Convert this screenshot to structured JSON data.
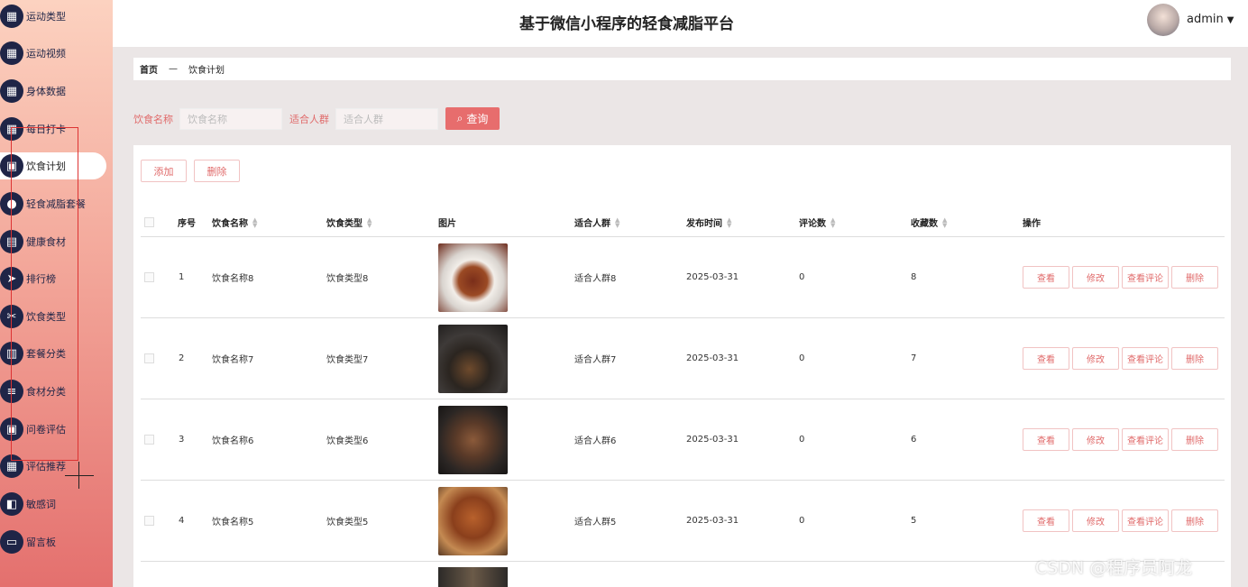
{
  "header": {
    "title": "基于微信小程序的轻食减脂平台",
    "user": "admin"
  },
  "sidebar": {
    "items": [
      {
        "label": "运动类型",
        "icon": "grid-icon"
      },
      {
        "label": "运动视频",
        "icon": "grid-icon"
      },
      {
        "label": "身体数据",
        "icon": "grid-icon"
      },
      {
        "label": "每日打卡",
        "icon": "grid-icon"
      },
      {
        "label": "饮食计划",
        "icon": "board-icon"
      },
      {
        "label": "轻食减脂套餐",
        "icon": "user-icon"
      },
      {
        "label": "健康食材",
        "icon": "clipboard-icon"
      },
      {
        "label": "排行榜",
        "icon": "send-icon"
      },
      {
        "label": "饮食类型",
        "icon": "ticket-icon"
      },
      {
        "label": "套餐分类",
        "icon": "bar-chart-icon"
      },
      {
        "label": "食材分类",
        "icon": "sliders-icon"
      },
      {
        "label": "问卷评估",
        "icon": "board-icon"
      },
      {
        "label": "评估推荐",
        "icon": "grid-icon"
      },
      {
        "label": "敏感词",
        "icon": "wallet-icon"
      },
      {
        "label": "留言板",
        "icon": "briefcase-icon"
      }
    ],
    "active_index": 4
  },
  "breadcrumb": {
    "home": "首页",
    "sep": "—",
    "current": "饮食计划"
  },
  "search": {
    "name_label": "饮食名称",
    "name_placeholder": "饮食名称",
    "crowd_label": "适合人群",
    "crowd_placeholder": "适合人群",
    "query_label": "查询"
  },
  "toolbar": {
    "add_label": "添加",
    "delete_label": "删除"
  },
  "table": {
    "headers": [
      "序号",
      "饮食名称",
      "饮食类型",
      "图片",
      "适合人群",
      "发布时间",
      "评论数",
      "收藏数",
      "操作"
    ],
    "rows": [
      {
        "no": "1",
        "name": "饮食名称8",
        "type": "饮食类型8",
        "crowd": "适合人群8",
        "date": "2025-03-31",
        "comments": "0",
        "favorites": "8",
        "image": "plated-meat-dish"
      },
      {
        "no": "2",
        "name": "饮食名称7",
        "type": "饮食类型7",
        "crowd": "适合人群7",
        "date": "2025-03-31",
        "comments": "0",
        "favorites": "7",
        "image": "teapot-and-plate"
      },
      {
        "no": "3",
        "name": "饮食名称6",
        "type": "饮食类型6",
        "crowd": "适合人群6",
        "date": "2025-03-31",
        "comments": "0",
        "favorites": "6",
        "image": "grilled-lamb-chops"
      },
      {
        "no": "4",
        "name": "饮食名称5",
        "type": "饮食类型5",
        "crowd": "适合人群5",
        "date": "2025-03-31",
        "comments": "0",
        "favorites": "5",
        "image": "roast-chicken"
      }
    ],
    "row_actions": [
      "查看",
      "修改",
      "查看评论",
      "删除"
    ]
  },
  "watermark": "CSDN @程序员阿龙",
  "colors": {
    "accent": "#e76d6d",
    "sidebar_icon": "#1f2547"
  }
}
